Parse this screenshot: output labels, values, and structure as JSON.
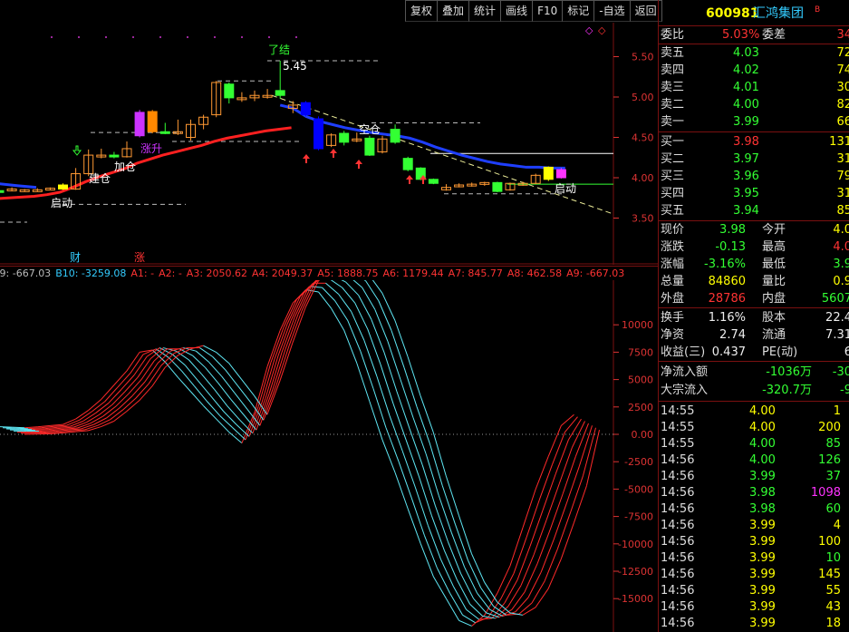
{
  "toolbar": {
    "buttons": [
      "复权",
      "叠加",
      "统计",
      "画线",
      "F10",
      "标记",
      "-自选",
      "返回"
    ]
  },
  "header": {
    "code": "600981",
    "name": "汇鸿集团",
    "badge": "B"
  },
  "quote": {
    "weibi_label": "委比",
    "weibi_value": "5.03%",
    "weicha_label": "委差",
    "weicha_value": "34",
    "asks": [
      {
        "label": "卖五",
        "price": "4.03",
        "vol": "72"
      },
      {
        "label": "卖四",
        "price": "4.02",
        "vol": "74"
      },
      {
        "label": "卖三",
        "price": "4.01",
        "vol": "30"
      },
      {
        "label": "卖二",
        "price": "4.00",
        "vol": "82"
      },
      {
        "label": "卖一",
        "price": "3.99",
        "vol": "66"
      }
    ],
    "bids": [
      {
        "label": "买一",
        "price": "3.98",
        "vol": "131"
      },
      {
        "label": "买二",
        "price": "3.97",
        "vol": "31"
      },
      {
        "label": "买三",
        "price": "3.96",
        "vol": "79"
      },
      {
        "label": "买四",
        "price": "3.95",
        "vol": "31"
      },
      {
        "label": "买五",
        "price": "3.94",
        "vol": "85"
      }
    ],
    "stats": [
      {
        "l1": "现价",
        "v1": "3.98",
        "l2": "今开",
        "v2": "4.0"
      },
      {
        "l1": "涨跌",
        "v1": "-0.13",
        "l2": "最高",
        "v2": "4.0"
      },
      {
        "l1": "涨幅",
        "v1": "-3.16%",
        "l2": "最低",
        "v2": "3.9"
      },
      {
        "l1": "总量",
        "v1": "84860",
        "l2": "量比",
        "v2": "0.9"
      },
      {
        "l1": "外盘",
        "v1": "28786",
        "l2": "内盘",
        "v2": "5607"
      }
    ],
    "stats2": [
      {
        "l1": "换手",
        "v1": "1.16%",
        "l2": "股本",
        "v2": "22.4"
      },
      {
        "l1": "净资",
        "v1": "2.74",
        "l2": "流通",
        "v2": "7.31"
      },
      {
        "l1": "收益(三)",
        "v1": "0.437",
        "l2": "PE(动)",
        "v2": "6"
      }
    ],
    "flows": [
      {
        "label": "净流入额",
        "v1": "-1036万",
        "v2": "-30"
      },
      {
        "label": "大宗流入",
        "v1": "-320.7万",
        "v2": "-9"
      }
    ]
  },
  "ticks": [
    {
      "t": "14:55",
      "p": "4.00",
      "v": "1",
      "c": "yel"
    },
    {
      "t": "14:55",
      "p": "4.00",
      "v": "200",
      "c": "yel"
    },
    {
      "t": "14:55",
      "p": "4.00",
      "v": "85",
      "c": "grn"
    },
    {
      "t": "14:56",
      "p": "4.00",
      "v": "126",
      "c": "grn"
    },
    {
      "t": "14:56",
      "p": "3.99",
      "v": "37",
      "c": "grn"
    },
    {
      "t": "14:56",
      "p": "3.98",
      "v": "1098",
      "c": "mag"
    },
    {
      "t": "14:56",
      "p": "3.98",
      "v": "60",
      "c": "grn"
    },
    {
      "t": "14:56",
      "p": "3.99",
      "v": "4",
      "c": "yel"
    },
    {
      "t": "14:56",
      "p": "3.99",
      "v": "100",
      "c": "yel"
    },
    {
      "t": "14:56",
      "p": "3.99",
      "v": "10",
      "c": "grn"
    },
    {
      "t": "14:56",
      "p": "3.99",
      "v": "145",
      "c": "yel"
    },
    {
      "t": "14:56",
      "p": "3.99",
      "v": "55",
      "c": "yel"
    },
    {
      "t": "14:56",
      "p": "3.99",
      "v": "43",
      "c": "yel"
    },
    {
      "t": "14:56",
      "p": "3.99",
      "v": "18",
      "c": "yel"
    }
  ],
  "price_axis": [
    "5.50",
    "5.00",
    "4.50",
    "4.00",
    "3.50"
  ],
  "indicator_axis": [
    "10000",
    "7500",
    "5000",
    "2500",
    "0.00",
    "-2500",
    "-5000",
    "-7500",
    "-10000",
    "-12500",
    "-15000"
  ],
  "indicator_legend": [
    "A9: -667.03",
    "B10: -3259.08",
    "A1: -",
    "A2: -",
    "A3: 2050.62",
    "A4: 2049.37",
    "A5: 1888.75",
    "A6: 1179.44",
    "A7: 845.77",
    "A8: 462.58",
    "A9: -667.03"
  ],
  "annotations": {
    "liaojie": "了结",
    "peak": "5.45",
    "jiancang": "建仓",
    "jiacang": "加仓",
    "zhangsheng": "涨升",
    "kongcang": "空仓",
    "qidong_left": "启动",
    "qidong_right": "启动",
    "cai": "财",
    "zhang": "涨"
  },
  "colors": {
    "up": "#ff3333",
    "down": "#33ff33",
    "accent": "#ffff00",
    "ma": "#ff2020",
    "ma2": "#1f3fff"
  },
  "candles": [
    {
      "o": 3.84,
      "c": 3.82,
      "h": 3.86,
      "l": 3.8
    },
    {
      "o": 3.84,
      "c": 3.86,
      "h": 3.88,
      "l": 3.83
    },
    {
      "o": 3.85,
      "c": 3.85,
      "h": 3.86,
      "l": 3.83
    },
    {
      "o": 3.85,
      "c": 3.85,
      "h": 3.87,
      "l": 3.83
    },
    {
      "o": 3.87,
      "c": 3.87,
      "h": 3.88,
      "l": 3.85
    },
    {
      "o": 3.91,
      "c": 3.86,
      "h": 3.93,
      "l": 3.85
    },
    {
      "o": 3.86,
      "c": 4.05,
      "h": 4.12,
      "l": 3.85
    },
    {
      "o": 4.05,
      "c": 4.28,
      "h": 4.35,
      "l": 4.02
    },
    {
      "o": 4.26,
      "c": 4.28,
      "h": 4.36,
      "l": 4.24
    },
    {
      "o": 4.28,
      "c": 4.27,
      "h": 4.32,
      "l": 4.24
    },
    {
      "o": 4.26,
      "c": 4.36,
      "h": 4.45,
      "l": 4.25
    },
    {
      "o": 4.52,
      "c": 4.81,
      "h": 4.84,
      "l": 4.5
    },
    {
      "o": 4.82,
      "c": 4.57,
      "h": 4.84,
      "l": 4.55
    },
    {
      "o": 4.57,
      "c": 4.56,
      "h": 4.68,
      "l": 4.54
    },
    {
      "o": 4.56,
      "c": 4.57,
      "h": 4.72,
      "l": 4.53
    },
    {
      "o": 4.5,
      "c": 4.66,
      "h": 4.72,
      "l": 4.46
    },
    {
      "o": 4.66,
      "c": 4.75,
      "h": 4.78,
      "l": 4.6
    },
    {
      "o": 4.78,
      "c": 5.18,
      "h": 5.2,
      "l": 4.75
    },
    {
      "o": 5.16,
      "c": 4.99,
      "h": 5.18,
      "l": 4.92
    },
    {
      "o": 4.98,
      "c": 4.99,
      "h": 5.06,
      "l": 4.94
    },
    {
      "o": 4.99,
      "c": 5.02,
      "h": 5.08,
      "l": 4.95
    },
    {
      "o": 5.02,
      "c": 5.02,
      "h": 5.1,
      "l": 4.98
    },
    {
      "o": 5.08,
      "c": 5.02,
      "h": 5.45,
      "l": 4.98
    },
    {
      "o": 4.86,
      "c": 4.9,
      "h": 4.95,
      "l": 4.8
    },
    {
      "o": 4.93,
      "c": 4.78,
      "h": 4.95,
      "l": 4.76
    },
    {
      "o": 4.73,
      "c": 4.36,
      "h": 4.76,
      "l": 4.34
    },
    {
      "o": 4.4,
      "c": 4.53,
      "h": 4.55,
      "l": 4.38
    },
    {
      "o": 4.55,
      "c": 4.44,
      "h": 4.58,
      "l": 4.4
    },
    {
      "o": 4.46,
      "c": 4.48,
      "h": 4.56,
      "l": 4.44
    },
    {
      "o": 4.49,
      "c": 4.28,
      "h": 4.52,
      "l": 4.27
    },
    {
      "o": 4.32,
      "c": 4.48,
      "h": 4.52,
      "l": 4.3
    },
    {
      "o": 4.6,
      "c": 4.44,
      "h": 4.66,
      "l": 4.42
    },
    {
      "o": 4.24,
      "c": 4.1,
      "h": 4.26,
      "l": 4.08
    },
    {
      "o": 4.12,
      "c": 3.98,
      "h": 4.13,
      "l": 3.97
    },
    {
      "o": 3.98,
      "c": 3.93,
      "h": 3.99,
      "l": 3.92
    },
    {
      "o": 3.85,
      "c": 3.88,
      "h": 3.92,
      "l": 3.84
    },
    {
      "o": 3.91,
      "c": 3.91,
      "h": 3.93,
      "l": 3.88
    },
    {
      "o": 3.92,
      "c": 3.92,
      "h": 3.94,
      "l": 3.89
    },
    {
      "o": 3.94,
      "c": 3.94,
      "h": 3.95,
      "l": 3.9
    },
    {
      "o": 3.94,
      "c": 3.83,
      "h": 3.95,
      "l": 3.82
    },
    {
      "o": 3.85,
      "c": 3.93,
      "h": 3.94,
      "l": 3.84
    },
    {
      "o": 3.92,
      "c": 3.93,
      "h": 3.95,
      "l": 3.9
    },
    {
      "o": 3.93,
      "c": 4.03,
      "h": 4.05,
      "l": 3.92
    },
    {
      "o": 3.98,
      "c": 4.13,
      "h": 4.14,
      "l": 3.96
    },
    {
      "o": 4.0,
      "c": 4.1,
      "h": 4.12,
      "l": 3.99
    }
  ],
  "ma_red": [
    3.74,
    3.75,
    3.76,
    3.77,
    3.79,
    3.82,
    3.88,
    3.95,
    4.01,
    4.06,
    4.11,
    4.18,
    4.23,
    4.28,
    4.32,
    4.36,
    4.4,
    4.45,
    4.49,
    4.52,
    4.55,
    4.58,
    4.6,
    4.62
  ],
  "ma_blue": [
    4.9,
    4.86,
    4.76,
    4.7,
    4.66,
    4.62,
    4.59,
    4.56,
    4.54,
    4.52,
    4.49,
    4.44,
    4.38,
    4.33,
    4.28,
    4.24,
    4.2,
    4.17,
    4.15,
    4.13,
    4.13,
    4.12,
    4.12
  ],
  "indicator_series": [
    [
      700,
      650,
      600,
      680,
      800,
      900,
      1400,
      2200,
      3200,
      4500,
      5800,
      7500,
      7700,
      6600,
      5200,
      3900,
      2600,
      1400,
      200,
      -800,
      2000,
      6200,
      9500,
      12000,
      13200,
      13000,
      11500,
      9500,
      6500,
      3000,
      -500,
      -3500,
      -6800,
      -10000,
      -13000,
      -15000,
      -17000,
      -17500,
      -16500,
      -14500,
      -12000,
      -8500,
      -5000,
      -2000,
      800,
      1800
    ],
    [
      600,
      560,
      520,
      600,
      720,
      820,
      1300,
      2100,
      3000,
      4300,
      5600,
      7300,
      7800,
      7000,
      5800,
      4400,
      3000,
      1700,
      600,
      -500,
      2500,
      6600,
      9800,
      12300,
      13500,
      13400,
      12200,
      10400,
      7600,
      4200,
      600,
      -2500,
      -5800,
      -9200,
      -12200,
      -14500,
      -16500,
      -17200,
      -16700,
      -15000,
      -12700,
      -9400,
      -6000,
      -2800,
      200,
      1600
    ],
    [
      500,
      470,
      440,
      520,
      640,
      740,
      1200,
      1950,
      2850,
      4100,
      5400,
      7100,
      7900,
      7300,
      6300,
      4900,
      3500,
      2100,
      900,
      -200,
      2900,
      6900,
      10100,
      12600,
      13800,
      13800,
      12800,
      11200,
      8600,
      5300,
      1700,
      -1500,
      -4800,
      -8300,
      -11400,
      -13900,
      -16000,
      -16900,
      -16800,
      -15400,
      -13300,
      -10200,
      -6900,
      -3600,
      -500,
      1400
    ],
    [
      400,
      380,
      360,
      440,
      560,
      660,
      1100,
      1800,
      2700,
      3900,
      5200,
      6900,
      7900,
      7600,
      6800,
      5500,
      4100,
      2600,
      1300,
      100,
      3300,
      7200,
      10400,
      12900,
      14100,
      14200,
      13400,
      12000,
      9600,
      6400,
      2800,
      -500,
      -3800,
      -7400,
      -10600,
      -13300,
      -15500,
      -16600,
      -16800,
      -15700,
      -13800,
      -11000,
      -7800,
      -4500,
      -1200,
      1200
    ],
    [
      300,
      290,
      280,
      360,
      480,
      580,
      1000,
      1650,
      2550,
      3700,
      5000,
      6700,
      7800,
      7800,
      7200,
      6100,
      4700,
      3200,
      1800,
      400,
      3700,
      7500,
      10700,
      13200,
      14400,
      14500,
      13900,
      12700,
      10500,
      7500,
      3900,
      500,
      -2800,
      -6500,
      -9800,
      -12700,
      -15000,
      -16300,
      -16700,
      -16000,
      -14400,
      -11800,
      -8700,
      -5400,
      -2000,
      1000
    ],
    [
      200,
      200,
      200,
      280,
      400,
      500,
      900,
      1500,
      2400,
      3500,
      4800,
      6500,
      7600,
      7900,
      7600,
      6600,
      5300,
      3800,
      2300,
      800,
      4100,
      7800,
      11000,
      13500,
      14600,
      14800,
      14400,
      13400,
      11400,
      8500,
      5000,
      1500,
      -1800,
      -5600,
      -9000,
      -12100,
      -14500,
      -16000,
      -16600,
      -16200,
      -14900,
      -12600,
      -9600,
      -6300,
      -2900,
      800
    ],
    [
      100,
      110,
      120,
      200,
      320,
      420,
      800,
      1350,
      2250,
      3300,
      4600,
      6300,
      7400,
      7900,
      7900,
      7100,
      5900,
      4400,
      2900,
      1300,
      4500,
      8100,
      11300,
      13800,
      14800,
      15000,
      14800,
      14000,
      12200,
      9500,
      6100,
      2500,
      -800,
      -4700,
      -8200,
      -11500,
      -14000,
      -15700,
      -16500,
      -16400,
      -15400,
      -13400,
      -10500,
      -7200,
      -3800,
      600
    ],
    [
      0,
      20,
      40,
      120,
      240,
      340,
      700,
      1200,
      2100,
      3100,
      4400,
      6100,
      7200,
      7800,
      8100,
      7500,
      6500,
      5000,
      3500,
      1800,
      4900,
      8400,
      11600,
      14000,
      15000,
      15200,
      15100,
      14500,
      12900,
      10400,
      7100,
      3500,
      200,
      -3800,
      -7400,
      -10900,
      -13500,
      -15300,
      -16300,
      -16500,
      -15800,
      -14100,
      -11400,
      -8100,
      -4700,
      400
    ]
  ]
}
